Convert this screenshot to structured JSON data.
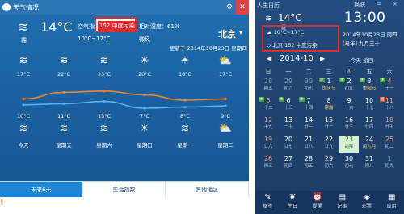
{
  "weather": {
    "title": "天气情况",
    "now": {
      "icon": "cloudy-icon",
      "temp": "14°C",
      "desc": "霾"
    },
    "aq_label": "空气指数：",
    "aq_value": "152 中度污染",
    "humidity": "相对湿度：61%",
    "range": "10°C~17°C",
    "wind": "微风",
    "city": "北京",
    "updated": "更新于 2014年10月23日 星期四",
    "forecast": [
      {
        "day_icon": "haze-icon",
        "high": "17°C",
        "low": "10°C",
        "night_icon": "haze-icon",
        "day": "今天"
      },
      {
        "day_icon": "haze-icon",
        "high": "22°C",
        "low": "11°C",
        "night_icon": "haze-icon",
        "day": "星期五"
      },
      {
        "day_icon": "haze-icon",
        "high": "23°C",
        "low": "13°C",
        "night_icon": "haze-icon",
        "day": "星期六"
      },
      {
        "day_icon": "sun-icon",
        "high": "20°C",
        "low": "7°C",
        "night_icon": "sun-icon",
        "day": "星期日"
      },
      {
        "day_icon": "sun-icon",
        "high": "16°C",
        "low": "8°C",
        "night_icon": "haze-icon",
        "day": "星期一"
      },
      {
        "day_icon": "partly-cloudy-icon",
        "high": "17°C",
        "low": "9°C",
        "night_icon": "partly-cloudy-icon",
        "day": "星期二"
      }
    ],
    "tabs": [
      "未来6天",
      "生活指数",
      "其他地区"
    ],
    "high_color": "#f0832a",
    "low_color": "#5bb0ea"
  },
  "calendar": {
    "title": "人生日历",
    "title_controls": [
      "换肤",
      "=",
      "×"
    ],
    "weather_temp": "14°C",
    "weather_cond": "霾",
    "time": "13:00",
    "date": "2014年10月23日 周四",
    "lunar": "[马年] 九月三十",
    "wbox_row1": "10°C~17°C",
    "wbox_row2": "北京 152 中度污染",
    "month": "2014-10",
    "today_btn": "今天 返回",
    "weekdays": [
      "日",
      "一",
      "二",
      "三",
      "四",
      "五",
      "六"
    ],
    "days": [
      {
        "d": "28",
        "l": "初五",
        "cls": "other"
      },
      {
        "d": "29",
        "l": "初六",
        "cls": "other"
      },
      {
        "d": "30",
        "l": "初七",
        "cls": "other"
      },
      {
        "d": "1",
        "l": "国庆节",
        "cls": "fest",
        "tag": "休"
      },
      {
        "d": "2",
        "l": "初九",
        "cls": "",
        "tag": "休"
      },
      {
        "d": "3",
        "l": "重阳节",
        "cls": "fest",
        "tag": "休"
      },
      {
        "d": "4",
        "l": "十一",
        "cls": "weekend",
        "tag": "休"
      },
      {
        "d": "5",
        "l": "十二",
        "cls": "weekend",
        "tag": "休"
      },
      {
        "d": "6",
        "l": "十三",
        "cls": "",
        "tag": "休"
      },
      {
        "d": "7",
        "l": "十四",
        "cls": "",
        "tag": "休"
      },
      {
        "d": "8",
        "l": "寒露",
        "cls": "fest"
      },
      {
        "d": "9",
        "l": "十六",
        "cls": ""
      },
      {
        "d": "10",
        "l": "十七",
        "cls": ""
      },
      {
        "d": "11",
        "l": "十八",
        "cls": "weekend",
        "tag": "班",
        "tagcls": "ban"
      },
      {
        "d": "12",
        "l": "十九",
        "cls": "weekend"
      },
      {
        "d": "13",
        "l": "二十",
        "cls": ""
      },
      {
        "d": "14",
        "l": "廿一",
        "cls": ""
      },
      {
        "d": "15",
        "l": "廿二",
        "cls": ""
      },
      {
        "d": "16",
        "l": "廿三",
        "cls": ""
      },
      {
        "d": "17",
        "l": "廿四",
        "cls": ""
      },
      {
        "d": "18",
        "l": "廿五",
        "cls": "weekend"
      },
      {
        "d": "19",
        "l": "廿六",
        "cls": "weekend"
      },
      {
        "d": "20",
        "l": "廿七",
        "cls": ""
      },
      {
        "d": "21",
        "l": "廿八",
        "cls": ""
      },
      {
        "d": "22",
        "l": "廿九",
        "cls": ""
      },
      {
        "d": "23",
        "l": "霜降",
        "cls": "today fest"
      },
      {
        "d": "24",
        "l": "闰九月",
        "cls": "fest"
      },
      {
        "d": "25",
        "l": "初二",
        "cls": "weekend"
      },
      {
        "d": "26",
        "l": "初三",
        "cls": "weekend"
      },
      {
        "d": "27",
        "l": "初四",
        "cls": ""
      },
      {
        "d": "28",
        "l": "初五",
        "cls": ""
      },
      {
        "d": "29",
        "l": "初六",
        "cls": ""
      },
      {
        "d": "30",
        "l": "初七",
        "cls": ""
      },
      {
        "d": "31",
        "l": "初八",
        "cls": ""
      },
      {
        "d": "1",
        "l": "初九",
        "cls": "other"
      }
    ],
    "toolbar": [
      {
        "icon": "pencil-icon",
        "label": "便签"
      },
      {
        "icon": "birthday-icon",
        "label": "生日"
      },
      {
        "icon": "alarm-icon",
        "label": "提醒"
      },
      {
        "icon": "notebook-icon",
        "label": "记事"
      },
      {
        "icon": "lottery-icon",
        "label": "彩票"
      },
      {
        "icon": "apps-icon",
        "label": "应用"
      }
    ]
  }
}
